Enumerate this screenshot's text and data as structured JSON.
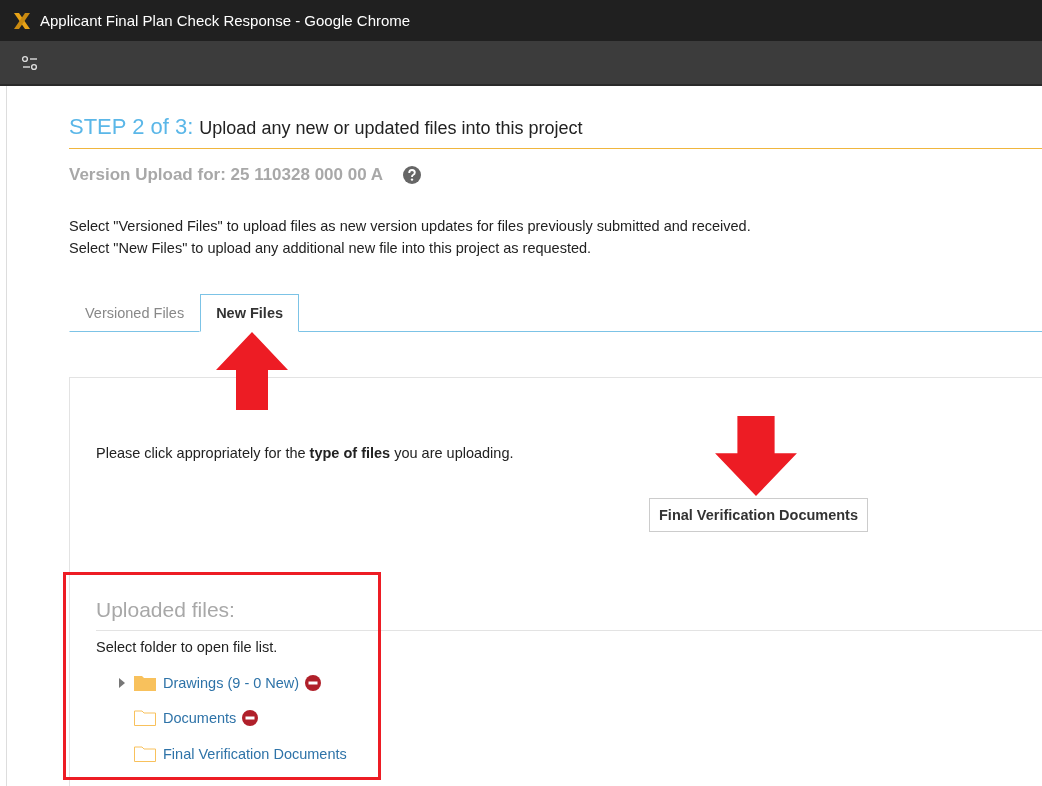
{
  "window": {
    "title": "Applicant Final Plan Check Response - Google Chrome"
  },
  "step": {
    "label": "STEP 2 of 3:",
    "title": "Upload any new or updated files into this project"
  },
  "version_upload": "Version Upload for: 25 110328 000 00 A",
  "instructions": [
    "Select \"Versioned Files\" to upload files as new version updates for files previously submitted and received.",
    "Select \"New Files\" to upload any additional new file into this project as requested."
  ],
  "tabs": [
    {
      "label": "Versioned Files",
      "selected": false
    },
    {
      "label": "New Files",
      "selected": true
    }
  ],
  "prompt": "Please click appropriately for the **type of files** you are uploading.",
  "type_buttons": [
    "Final Verification Documents"
  ],
  "uploaded": {
    "heading": "Uploaded files:",
    "hint": "Select folder to open file list.",
    "folders": [
      {
        "label": "Drawings (9 - 0 New)",
        "expandable": true,
        "has_files": true,
        "removable": true
      },
      {
        "label": "Documents",
        "expandable": false,
        "has_files": false,
        "removable": true
      },
      {
        "label": "Final Verification Documents",
        "expandable": false,
        "has_files": false,
        "removable": false
      }
    ]
  }
}
